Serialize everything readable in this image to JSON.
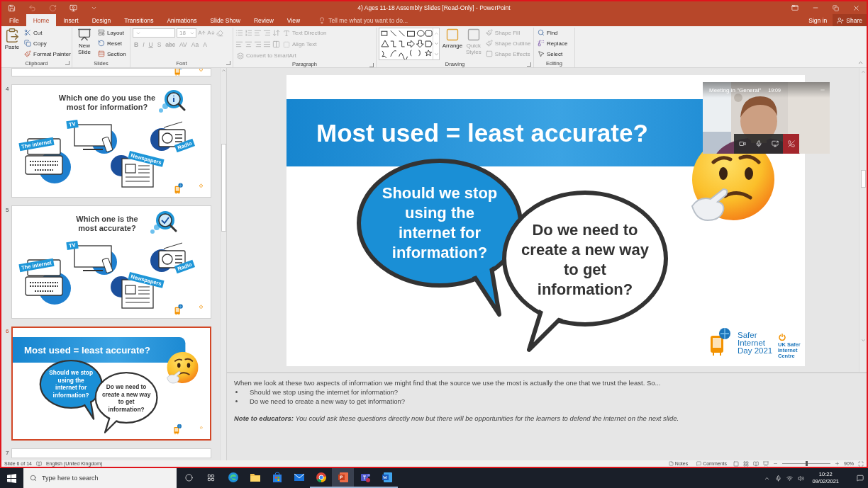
{
  "window": {
    "title": "4) Ages 11-18 Assembly Slides [Read-Only] - PowerPoint"
  },
  "ribbon": {
    "tabs": [
      {
        "label": "File",
        "selected": false
      },
      {
        "label": "Home",
        "selected": true
      },
      {
        "label": "Insert",
        "selected": false
      },
      {
        "label": "Design",
        "selected": false
      },
      {
        "label": "Transitions",
        "selected": false
      },
      {
        "label": "Animations",
        "selected": false
      },
      {
        "label": "Slide Show",
        "selected": false
      },
      {
        "label": "Review",
        "selected": false
      },
      {
        "label": "View",
        "selected": false
      }
    ],
    "tell_me": "Tell me what you want to do...",
    "sign_in": "Sign in",
    "share": "Share",
    "groups": [
      {
        "kind": "clipboard",
        "label": "Clipboard",
        "paste": "Paste",
        "cut": "Cut",
        "copy": "Copy",
        "format_painter": "Format Painter"
      },
      {
        "kind": "slides",
        "label": "Slides",
        "new_slide": "New Slide",
        "layout": "Layout",
        "reset": "Reset",
        "section": "Section"
      },
      {
        "kind": "font",
        "label": "Font",
        "font_size": "18",
        "disabled": true,
        "format_buttons": [
          "B",
          "I",
          "U",
          "S",
          "abc",
          "AV",
          "Aa",
          "A"
        ]
      },
      {
        "kind": "paragraph",
        "label": "Paragraph",
        "disabled": true,
        "text_direction": "Text Direction",
        "align_text": "Align Text",
        "convert": "Convert to SmartArt"
      },
      {
        "kind": "drawing",
        "label": "Drawing",
        "arrange": "Arrange",
        "quick_styles": "Quick Styles",
        "shape_fill": "Shape Fill",
        "shape_outline": "Shape Outline",
        "shape_effects": "Shape Effects",
        "styles_disabled": true
      },
      {
        "kind": "editing",
        "label": "Editing",
        "find": "Find",
        "replace": "Replace",
        "select": "Select"
      }
    ]
  },
  "thumbnails": [
    {
      "kind": "cut_bottom",
      "selected": false
    },
    {
      "number": "4",
      "kind": "devices",
      "selected": false,
      "title": "Which one do you use the most for information?",
      "tags": [
        "The internet",
        "TV",
        "Newspapers",
        "Radio"
      ]
    },
    {
      "number": "5",
      "kind": "devices",
      "selected": false,
      "title": "Which one is the most accurate?",
      "tags": [
        "The internet",
        "TV",
        "Newspapers",
        "Radio"
      ]
    },
    {
      "number": "6",
      "kind": "bubbles",
      "selected": true,
      "title": "Most used = least accurate?",
      "bubbles": [
        "Should we stop using the internet for information?",
        "Do we need to create a new way to get information?"
      ]
    },
    {
      "number": "7",
      "kind": "cut_top",
      "selected": false
    }
  ],
  "slide": {
    "title": "Most used = least accurate?",
    "bubbles": [
      "Should we stop using the internet for information?",
      "Do we need to create a new way to get information?"
    ],
    "logo_name": "Safer Internet Day 2021",
    "centre_name": "UK Safer Internet Centre"
  },
  "meeting": {
    "title": "Meeting in \"General\"",
    "time": "19:09"
  },
  "notes": {
    "intro": "When we look at these two aspects of information we might find that the source we use the most is actually the one that we trust the least. So...",
    "bullets": [
      "Should we stop using the internet for information?",
      "Do we need to create a new way to get information?"
    ],
    "note": "**Note to educators:** You could ask these questions directly now but there will be opportunities for the learners to defend the internet on the next slide."
  },
  "status_bar": {
    "slide": "Slide 6 of 14",
    "language": "English (United Kingdom)",
    "notes": "Notes",
    "comments": "Comments",
    "zoom": "90%",
    "zoom_slider": {
      "level": 0.5
    }
  },
  "taskbar": {
    "search_placeholder": "Type here to search",
    "apps": [
      {
        "running": false,
        "selected": false
      },
      {
        "running": false,
        "selected": false
      },
      {
        "running": false,
        "selected": false
      },
      {
        "running": false,
        "selected": false
      },
      {
        "running": true,
        "selected": false
      },
      {
        "running": true,
        "selected": true
      },
      {
        "running": true,
        "selected": false
      },
      {
        "running": true,
        "selected": false
      }
    ],
    "time": "10:22",
    "date": "09/02/2021"
  }
}
